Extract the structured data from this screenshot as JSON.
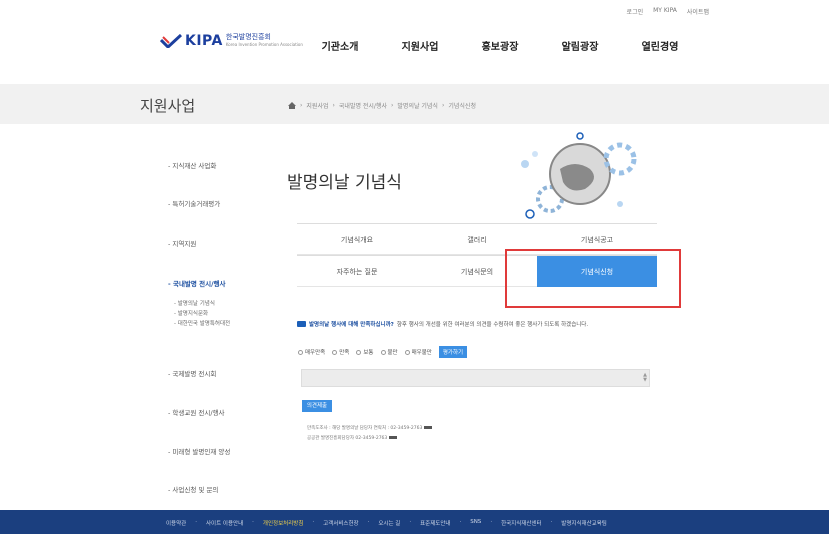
{
  "util": {
    "links": [
      "로그인",
      "MY KIPA",
      "사이트맵"
    ]
  },
  "logo": {
    "brand": "KIPA",
    "korean": "한국발명진흥회",
    "tagline": "Korea Invention Promotion Association"
  },
  "gnb": [
    "기관소개",
    "지원사업",
    "홍보광장",
    "알림광장",
    "열린경영"
  ],
  "subhead": {
    "title": "지원사업",
    "crumbs": [
      "지원사업",
      "국내발명 전시/행사",
      "발명의날 기념식",
      "기념식신청"
    ]
  },
  "lnb": {
    "items": [
      "지식재산 사업화",
      "특허기술거래평가",
      "지역지원",
      "국내발명 전시/행사",
      "국제발명 전시회",
      "학생교원 전시/행사",
      "미래형 발명인재 양성",
      "사업신청 및 문의"
    ],
    "sub": [
      "발명의날 기념식",
      "발명지식문화",
      "대한민국 발명특허대전"
    ]
  },
  "content": {
    "title": "발명의날 기념식",
    "tabs_row1": [
      "기념식개요",
      "갤러리",
      "기념식공고"
    ],
    "tabs_row2": [
      "자주하는 질문",
      "기념식문의",
      "기념식신청"
    ],
    "notice_strong": "발명의날 행사에 대해 만족하십니까?",
    "notice_rest": "향후 행사의 개선을 위한 여러분의 의견을 수렴하여 좋은 행사가 되도록 하겠습니다.",
    "radio_options": [
      "매우만족",
      "만족",
      "보통",
      "불만",
      "매우불만"
    ],
    "vote_button": "평가하기",
    "submit_button": "의견제출",
    "info_line1": "만족도조사 : 해당 발명의날 담당자   연락처 : 02-3459-2763",
    "info_line2": "           공공관 발명진흥회담당자   02-3459-2763"
  },
  "footer": {
    "links": [
      "이용약관",
      "사이트 이용안내",
      "개인정보처리방침",
      "고객서비스헌장",
      "오시는 길",
      "표준제도안내",
      "SNS",
      "한국지식재산센터",
      "발명지식재산교육팀"
    ],
    "highlight_index": 2
  },
  "colors": {
    "accent": "#3b8fe3",
    "brand": "#1c3f9e",
    "footer": "#1b3f7f",
    "highlight_box": "#e03a3a"
  }
}
